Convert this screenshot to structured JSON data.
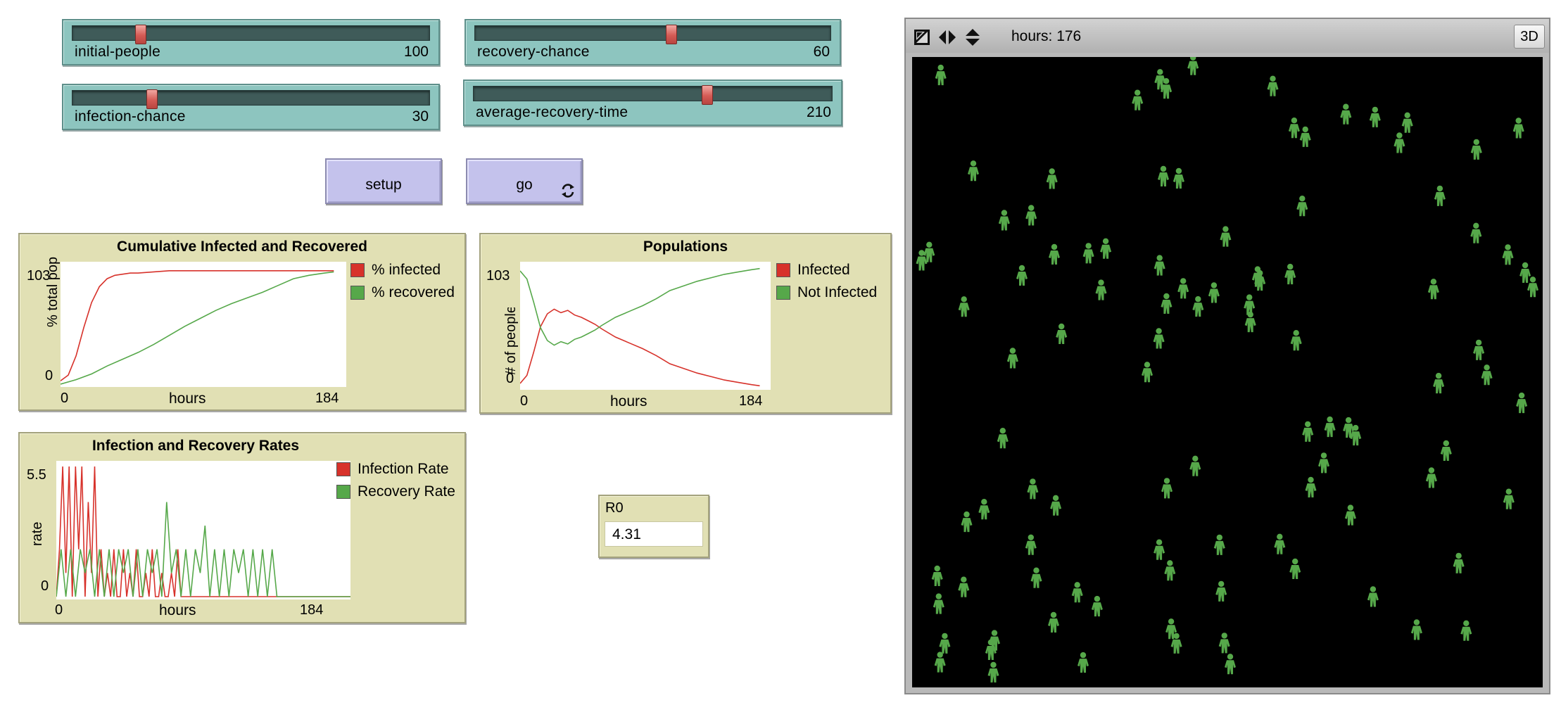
{
  "sliders": {
    "initial_people": {
      "label": "initial-people",
      "value": "100",
      "fraction": 0.19
    },
    "infection_chance": {
      "label": "infection-chance",
      "value": "30",
      "fraction": 0.22
    },
    "recovery_chance": {
      "label": "recovery-chance",
      "value": "60",
      "fraction": 0.55
    },
    "average_recovery_time": {
      "label": "average-recovery-time",
      "value": "210",
      "fraction": 0.65
    }
  },
  "buttons": {
    "setup": {
      "label": "setup"
    },
    "go": {
      "label": "go",
      "forever": true
    }
  },
  "plots": {
    "cumulative": {
      "title": "Cumulative Infected and Recovered",
      "ylabel": "% total pop",
      "xlabel": "hours",
      "xmin": "0",
      "xmax": "184",
      "ymin": "0",
      "ymax": "103",
      "legend": [
        {
          "label": "% infected",
          "color": "#d7322b"
        },
        {
          "label": "% recovered",
          "color": "#56a84a"
        }
      ]
    },
    "populations": {
      "title": "Populations",
      "ylabel": "# of people",
      "xlabel": "hours",
      "xmin": "0",
      "xmax": "184",
      "ymin": "0",
      "ymax": "103",
      "legend": [
        {
          "label": "Infected",
          "color": "#d7322b"
        },
        {
          "label": "Not Infected",
          "color": "#56a84a"
        }
      ]
    },
    "rates": {
      "title": "Infection and Recovery Rates",
      "ylabel": "rate",
      "xlabel": "hours",
      "xmin": "0",
      "xmax": "184",
      "ymin": "0",
      "ymax": "5.5",
      "legend": [
        {
          "label": "Infection Rate",
          "color": "#d7322b"
        },
        {
          "label": "Recovery Rate",
          "color": "#56a84a"
        }
      ]
    }
  },
  "chart_data": [
    {
      "type": "line",
      "title": "Cumulative Infected and Recovered",
      "xlabel": "hours",
      "ylabel": "% total pop",
      "xlim": [
        0,
        184
      ],
      "ylim": [
        0,
        103
      ],
      "series": [
        {
          "name": "% infected",
          "color": "#d7322b",
          "x": [
            0,
            5,
            10,
            15,
            20,
            25,
            30,
            35,
            40,
            45,
            50,
            60,
            70,
            80,
            100,
            120,
            140,
            160,
            176
          ],
          "y": [
            3,
            8,
            25,
            50,
            72,
            86,
            93,
            96,
            97,
            98,
            98,
            99,
            100,
            100,
            100,
            100,
            100,
            100,
            100
          ]
        },
        {
          "name": "% recovered",
          "color": "#56a84a",
          "x": [
            0,
            10,
            20,
            30,
            40,
            50,
            60,
            70,
            80,
            90,
            100,
            110,
            120,
            130,
            140,
            150,
            160,
            170,
            176
          ],
          "y": [
            0,
            4,
            9,
            16,
            22,
            28,
            35,
            43,
            51,
            58,
            65,
            71,
            76,
            81,
            87,
            93,
            96,
            98,
            99
          ]
        }
      ]
    },
    {
      "type": "line",
      "title": "Populations",
      "xlabel": "hours",
      "ylabel": "# of people",
      "xlim": [
        0,
        184
      ],
      "ylim": [
        0,
        103
      ],
      "series": [
        {
          "name": "Infected",
          "color": "#d7322b",
          "x": [
            0,
            5,
            10,
            15,
            20,
            25,
            30,
            35,
            40,
            45,
            50,
            55,
            60,
            70,
            80,
            90,
            100,
            110,
            120,
            130,
            140,
            150,
            160,
            170,
            176
          ],
          "y": [
            3,
            10,
            30,
            52,
            63,
            67,
            64,
            66,
            62,
            60,
            57,
            54,
            50,
            43,
            38,
            33,
            27,
            20,
            16,
            12,
            9,
            6,
            4,
            2,
            1
          ]
        },
        {
          "name": "Not Infected",
          "color": "#56a84a",
          "x": [
            0,
            5,
            10,
            15,
            20,
            25,
            30,
            35,
            40,
            45,
            50,
            55,
            60,
            70,
            80,
            90,
            100,
            110,
            120,
            130,
            140,
            150,
            160,
            170,
            176
          ],
          "y": [
            100,
            93,
            73,
            51,
            40,
            36,
            39,
            37,
            41,
            43,
            46,
            49,
            53,
            60,
            65,
            70,
            76,
            83,
            87,
            91,
            94,
            97,
            99,
            101,
            102
          ]
        }
      ]
    },
    {
      "type": "line",
      "title": "Infection and Recovery Rates",
      "xlabel": "hours",
      "ylabel": "rate",
      "xlim": [
        0,
        184
      ],
      "ylim": [
        0,
        5.5
      ],
      "series": [
        {
          "name": "Infection Rate",
          "color": "#d7322b",
          "x": [
            0,
            2,
            4,
            6,
            8,
            10,
            12,
            14,
            16,
            18,
            20,
            22,
            24,
            26,
            28,
            30,
            32,
            34,
            36,
            38,
            40,
            42,
            44,
            46,
            48,
            50,
            52,
            54,
            56,
            58,
            60,
            62,
            64,
            66,
            68,
            70,
            72,
            74,
            76,
            78,
            80,
            184
          ],
          "y": [
            0,
            2,
            5.5,
            1,
            5.5,
            0,
            5.5,
            2,
            5.5,
            0,
            4,
            1,
            5.5,
            0,
            2,
            0,
            1,
            0,
            2,
            0,
            0,
            2,
            0,
            1,
            0,
            2,
            0,
            0,
            1,
            0,
            2,
            0,
            0,
            1,
            0,
            0,
            1,
            0,
            2,
            0,
            0,
            0
          ]
        },
        {
          "name": "Recovery Rate",
          "color": "#56a84a",
          "x": [
            0,
            3,
            6,
            9,
            12,
            15,
            18,
            21,
            24,
            27,
            30,
            33,
            36,
            39,
            42,
            45,
            48,
            51,
            54,
            57,
            60,
            63,
            66,
            69,
            72,
            75,
            78,
            81,
            84,
            87,
            90,
            93,
            96,
            99,
            102,
            105,
            108,
            111,
            114,
            117,
            120,
            123,
            126,
            129,
            132,
            135,
            138,
            140,
            184
          ],
          "y": [
            0,
            2,
            0,
            2,
            0,
            2,
            1,
            2,
            0,
            2,
            0,
            2,
            0,
            2,
            1,
            2,
            0,
            2,
            0,
            2,
            1,
            2,
            0,
            4,
            1,
            2,
            0,
            2,
            0,
            2,
            1,
            3,
            0,
            2,
            0,
            2,
            0,
            2,
            1,
            2,
            0,
            2,
            0,
            2,
            0,
            2,
            0,
            0,
            0
          ]
        }
      ]
    }
  ],
  "monitor": {
    "label": "R0",
    "value": "4.31"
  },
  "view": {
    "ticks_label": "hours: 176",
    "three_d_label": "3D",
    "world_background": "#000000",
    "person_color": "#56a84a",
    "person_shape": "person-icon"
  }
}
